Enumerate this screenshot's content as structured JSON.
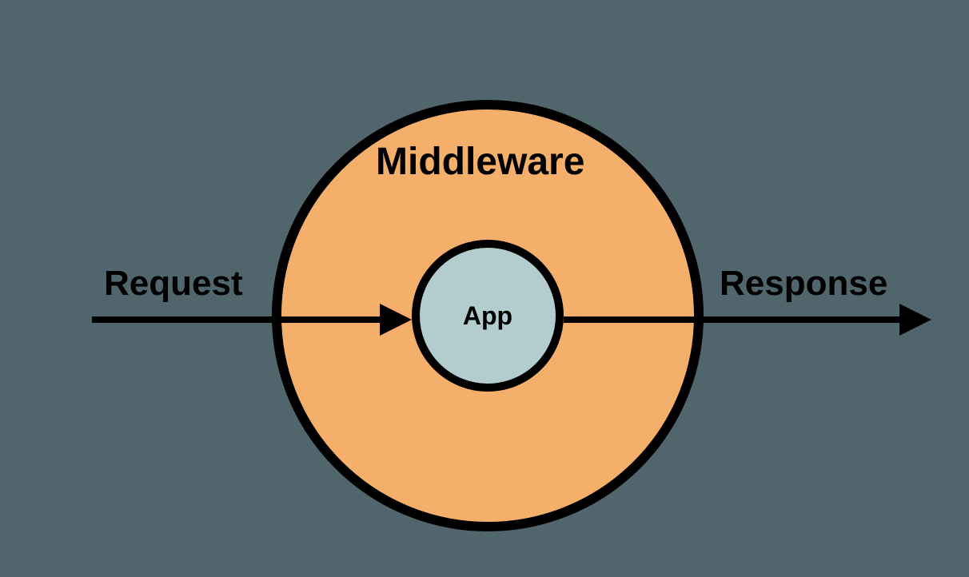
{
  "diagram": {
    "outer_label": "Middleware",
    "inner_label": "App",
    "left_label": "Request",
    "right_label": "Response",
    "colors": {
      "background": "#51666c",
      "outer_circle": "#f4b06a",
      "inner_circle": "#b3ccce",
      "stroke": "#000000"
    }
  }
}
